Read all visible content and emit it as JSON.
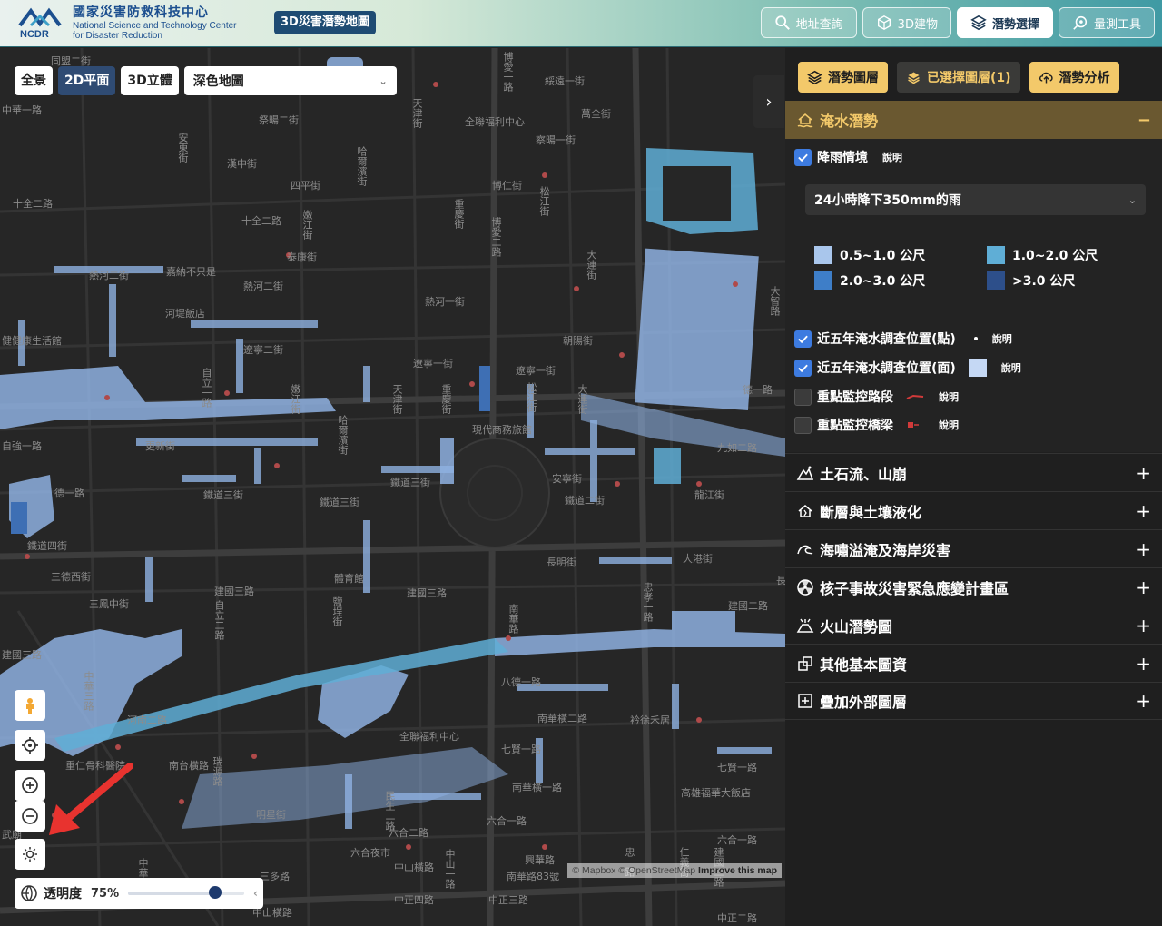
{
  "header": {
    "org_zh": "國家災害防救科技中心",
    "org_en_1": "National Science and Technology Center",
    "org_en_2": "for Disaster Reduction",
    "logo_text": "NCDR",
    "site_title": "3D災害潛勢地圖",
    "nav": [
      {
        "label": "地址查詢",
        "icon": "search-icon"
      },
      {
        "label": "3D建物",
        "icon": "cube-icon"
      },
      {
        "label": "潛勢選擇",
        "icon": "layers-icon",
        "active": true
      },
      {
        "label": "量測工具",
        "icon": "measure-icon"
      }
    ]
  },
  "map": {
    "view_buttons": [
      "全景",
      "2D平面",
      "3D立體"
    ],
    "active_view": "2D平面",
    "basemap": "深色地圖",
    "opacity_label": "透明度",
    "opacity_value": "75%",
    "opacity_fraction": 0.75,
    "attribution_1": "© Mapbox © OpenStreetMap",
    "attribution_2": "Improve this map",
    "colors": {
      "water_light": "#a9c6ec",
      "water_mid": "#6aa3d6",
      "water_dark": "#3e6fb4",
      "road": "#3a3a3a",
      "poi": "#b04a4a"
    },
    "labels": {
      "l1": "同盟二街",
      "l2": "博愛一路",
      "l3": "綏遠一街",
      "l4": "天津街",
      "l5": "全聯福利中心",
      "l6": "萬全街",
      "l7": "祭暘二街",
      "l8": "察暘一街",
      "l9": "安東街",
      "l10": "漢中街",
      "l11": "四平街",
      "l12": "哈爾濱街",
      "l13": "博仁街",
      "l14": "十全二路",
      "l15": "十全二路",
      "l16": "嫩江街",
      "l17": "重慶街",
      "l18": "博愛二路",
      "l19": "松江街",
      "l20": "泰康街",
      "l21": "熱河二街",
      "l22": "嘉納不只是",
      "l23": "熱河二街",
      "l24": "熱河一街",
      "l25": "河堤飯店",
      "l26": "朝陽街",
      "l27": "大連街",
      "l28": "健健康生活館",
      "l29": "遼寧二街",
      "l30": "遼寧一街",
      "l31": "遼寧一街",
      "l32": "自立一路",
      "l33": "嫩江街",
      "l34": "天津街",
      "l35": "重慶街",
      "l36": "松江街",
      "l37": "大連街",
      "l38": "現代商務旅館",
      "l39": "更新街",
      "l40": "哈爾濱街",
      "l41": "鐵道三街",
      "l42": "鐵道三街",
      "l43": "鐵道三街",
      "l44": "安寧街",
      "l45": "鐵道二街",
      "l46": "九如二路",
      "l47": "龍江街",
      "l48": "德一路",
      "l49": "鐵道四街",
      "l50": "長明街",
      "l51": "大港街",
      "l52": "三德西街",
      "l53": "體育館",
      "l54": "三鳳中街",
      "l55": "建國三路",
      "l56": "建國三路",
      "l57": "建國二路",
      "l58": "自立二路",
      "l59": "鹽埕街",
      "l60": "南華路",
      "l61": "忠孝一路",
      "l62": "中華三路",
      "l63": "八德一路",
      "l64": "南華橫二路",
      "l65": "衿徐禾居",
      "l66": "河南二路",
      "l67": "重仁骨科醫院",
      "l68": "南台橫路",
      "l69": "瑞源路",
      "l70": "全聯福利中心",
      "l71": "七賢一路",
      "l72": "七賢一路",
      "l73": "南華橫一路",
      "l74": "高雄福華大飯店",
      "l75": "明星街",
      "l76": "民生二路",
      "l77": "六合一路",
      "l78": "六合二路",
      "l79": "六合一路",
      "l80": "六合夜市",
      "l81": "中山橫路",
      "l82": "興華路",
      "l83": "南華路83號",
      "l84": "中正三路",
      "l85": "中正二路",
      "l86": "中正四路",
      "l87": "中山橫路",
      "l88": "三多路",
      "l89": "武廟",
      "l90": "中華一路",
      "l91": "中山一路",
      "l92": "自強一路",
      "l93": "建國三路",
      "l94": "中華一路",
      "l95": "長",
      "l96": "忠一路",
      "l97": "仁義街",
      "l98": "大智路",
      "l99": "德一路",
      "l100": "建國二路"
    }
  },
  "panel": {
    "tabs": [
      {
        "label": "潛勢圖層",
        "icon": "layers-icon"
      },
      {
        "label": "已選擇圖層(1)",
        "icon": "stack-icon"
      },
      {
        "label": "潛勢分析",
        "icon": "analysis-icon"
      }
    ],
    "section_title": "淹水潛勢",
    "rain_label": "降雨情境",
    "explain": "說明",
    "scenario": "24小時降下350mm的雨",
    "legend": [
      {
        "label": "0.5~1.0 公尺",
        "color": "#a9c6ec"
      },
      {
        "label": "1.0~2.0 公尺",
        "color": "#5faed6"
      },
      {
        "label": "2.0~3.0 公尺",
        "color": "#3e7ec8"
      },
      {
        "label": ">3.0 公尺",
        "color": "#2d4f8a"
      }
    ],
    "layers": [
      {
        "label": "近五年淹水調查位置(點)",
        "checked": true
      },
      {
        "label": "近五年淹水調查位置(面)",
        "checked": true
      },
      {
        "label": "重點監控路段",
        "checked": false
      },
      {
        "label": "重點監控橋梁",
        "checked": false
      }
    ],
    "collapsed": [
      {
        "label": "土石流、山崩",
        "icon": "landslide-icon"
      },
      {
        "label": "斷層與土壤液化",
        "icon": "fault-icon"
      },
      {
        "label": "海嘯溢淹及海岸災害",
        "icon": "wave-icon"
      },
      {
        "label": "核子事故災害緊急應變計畫區",
        "icon": "nuclear-icon"
      },
      {
        "label": "火山潛勢圖",
        "icon": "volcano-icon"
      },
      {
        "label": "其他基本圖資",
        "icon": "basemap-icon"
      },
      {
        "label": "疊加外部圖層",
        "icon": "add-layer-icon"
      }
    ]
  }
}
